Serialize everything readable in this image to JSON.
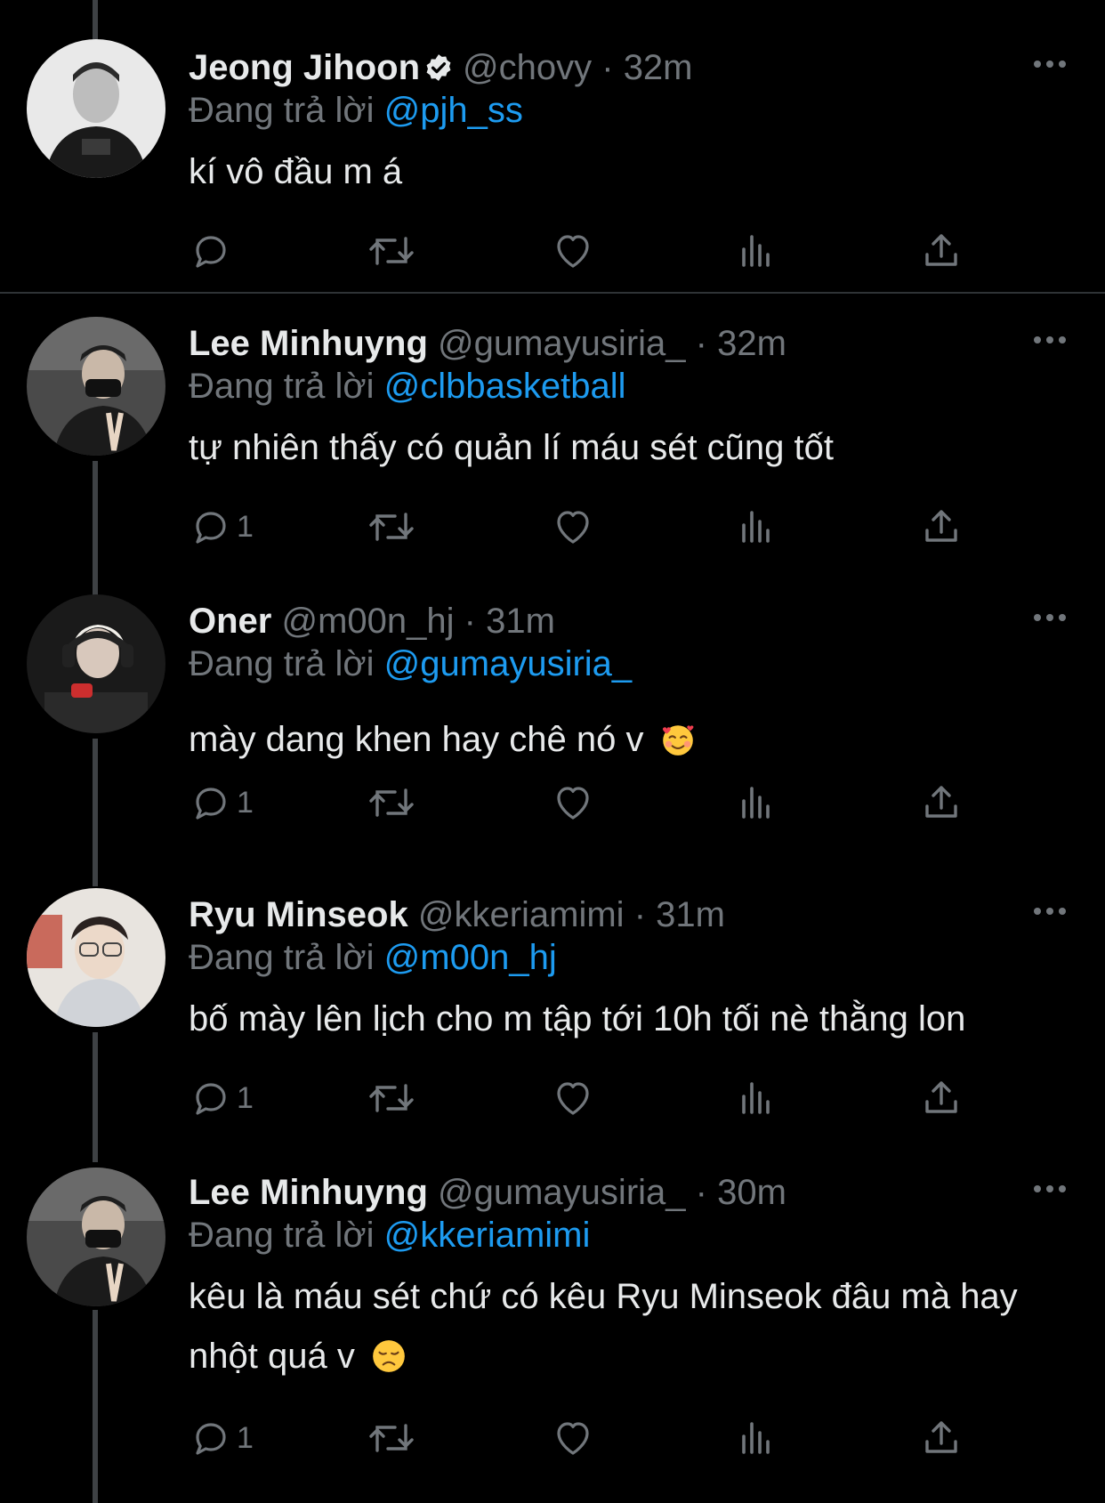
{
  "reply_prefix": "Đang trả lời",
  "colors": {
    "background": "#000000",
    "text": "#e7e9ea",
    "secondary": "#71767b",
    "accent": "#1d9bf0"
  },
  "tweets": [
    {
      "name": "Jeong Jihoon",
      "verified": true,
      "handle": "@chovy",
      "separator": "·",
      "time": "32m",
      "reply_to": "@pjh_ss",
      "text": "kí vô đầu m á",
      "reply_count": "",
      "avatar": "avatar-photo"
    },
    {
      "name": "Lee Minhuyng",
      "verified": false,
      "handle": "@gumayusiria_",
      "separator": "·",
      "time": "32m",
      "reply_to": "@clbbasketball",
      "text": "tự nhiên thấy có quản lí máu sét cũng tốt",
      "reply_count": "1",
      "avatar": "avatar-photo"
    },
    {
      "name": "Oner",
      "verified": false,
      "handle": "@m00n_hj",
      "separator": "·",
      "time": "31m",
      "reply_to": "@gumayusiria_",
      "text": "mày dang khen hay chê nó v",
      "emoji": "smiling-face-with-hearts-emoji",
      "reply_count": "1",
      "avatar": "avatar-photo"
    },
    {
      "name": "Ryu Minseok",
      "verified": false,
      "handle": "@kkeriamimi",
      "separator": "·",
      "time": "31m",
      "reply_to": "@m00n_hj",
      "text": "bố mày lên lịch cho m tập tới 10h tối nè thằng lon",
      "reply_count": "1",
      "avatar": "avatar-photo"
    },
    {
      "name": "Lee Minhuyng",
      "verified": false,
      "handle": "@gumayusiria_",
      "separator": "·",
      "time": "30m",
      "reply_to": "@kkeriamimi",
      "text": "kêu là máu sét chứ có kêu Ryu Minseok đâu mà hay nhột quá v",
      "emoji": "disappointed-face-emoji",
      "reply_count": "1",
      "avatar": "avatar-photo"
    }
  ]
}
